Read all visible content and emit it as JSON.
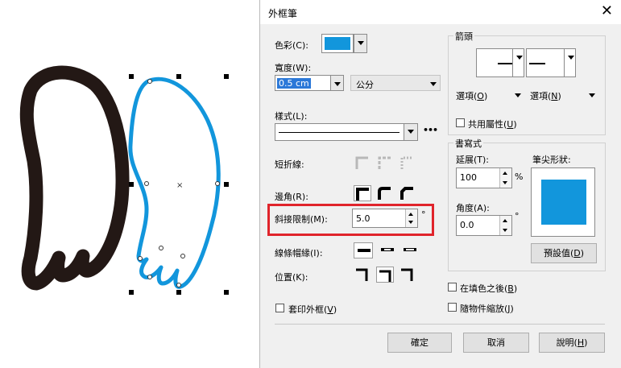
{
  "dialog": {
    "title": "外框筆",
    "close_glyph": "✕",
    "color": {
      "label": "色彩(C):",
      "swatch": "#1296dc"
    },
    "width": {
      "label": "寬度(W):",
      "value": "0.5 cm",
      "unit": "公分"
    },
    "style": {
      "label": "樣式(L):",
      "more": "•••"
    },
    "dash": {
      "label": "短折線:"
    },
    "corner": {
      "label": "邊角(R):"
    },
    "miter": {
      "label": "斜接限制(M):",
      "value": "5.0",
      "unit": "°"
    },
    "line_cap": {
      "label": "線條帽緣(I):"
    },
    "position": {
      "label": "位置(K):"
    },
    "overprint": {
      "label": "套印外框(",
      "hotkey": "V",
      "suffix": ")"
    },
    "arrows": {
      "title": "箭頭",
      "options_left": {
        "label": "選項(",
        "hotkey": "O",
        "suffix": ")"
      },
      "options_right": {
        "label": "選項(",
        "hotkey": "N",
        "suffix": ")"
      },
      "share": {
        "label": "共用屬性(",
        "hotkey": "U",
        "suffix": ")"
      }
    },
    "calligraphy": {
      "title": "書寫式",
      "stretch": {
        "label": "延展(T):",
        "value": "100",
        "unit": "%"
      },
      "angle": {
        "label": "角度(A):",
        "value": "0.0",
        "unit": "°"
      },
      "nib": {
        "label": "筆尖形狀:",
        "color": "#1296dc"
      },
      "default_btn": {
        "label": "預設值(",
        "hotkey": "D",
        "suffix": ")"
      }
    },
    "behind_fill": {
      "label": "在填色之後(",
      "hotkey": "B",
      "suffix": ")"
    },
    "scale_with": {
      "label": "隨物件縮放(",
      "hotkey": "J",
      "suffix": ")"
    },
    "buttons": {
      "ok": "確定",
      "cancel": "取消",
      "help": {
        "label": "說明(",
        "hotkey": "H",
        "suffix": ")"
      }
    }
  },
  "canvas": {
    "left_wing_color": "#231815",
    "right_wing_color": "#1296dc"
  }
}
